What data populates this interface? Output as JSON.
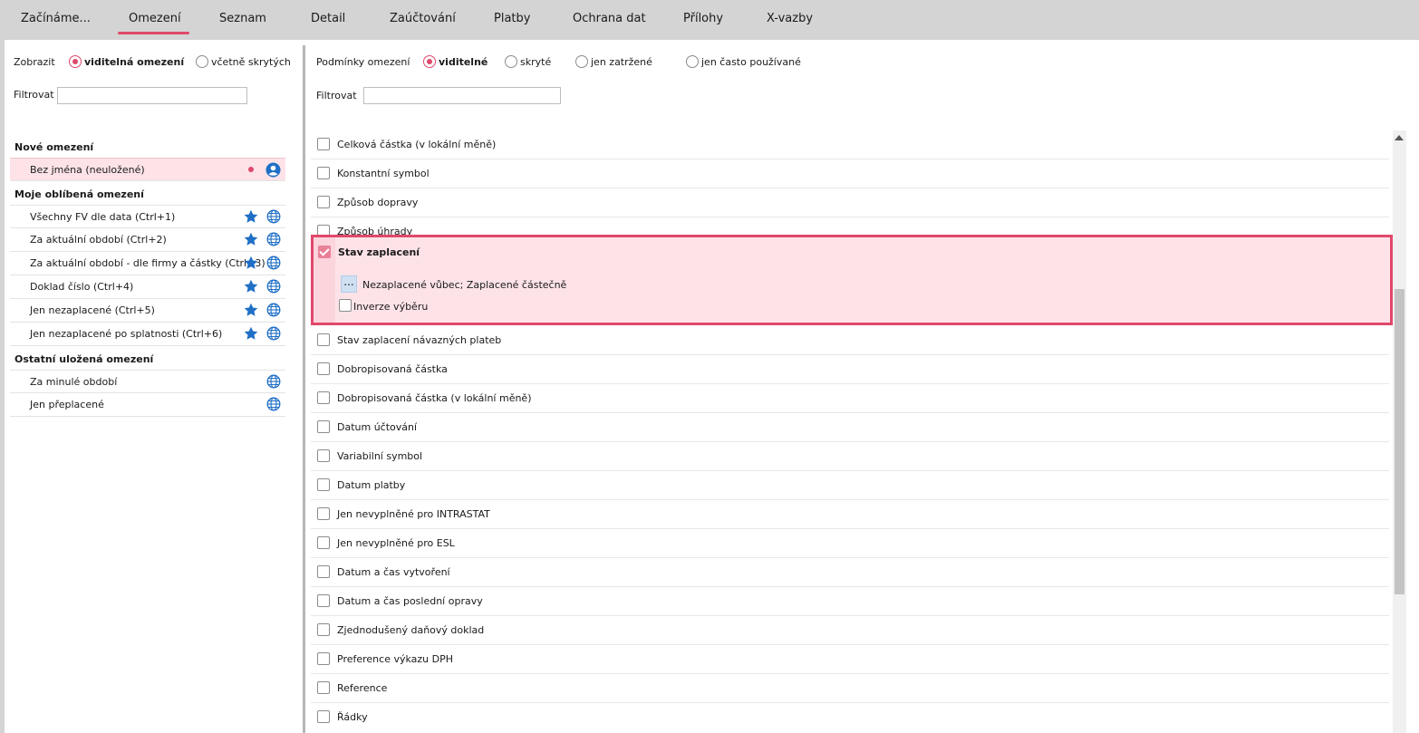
{
  "tabs": [
    {
      "label": "Začínáme...",
      "active": false
    },
    {
      "label": "Omezení",
      "active": true
    },
    {
      "label": "Seznam",
      "active": false
    },
    {
      "label": "Detail",
      "active": false
    },
    {
      "label": "Zaúčtování",
      "active": false
    },
    {
      "label": "Platby",
      "active": false
    },
    {
      "label": "Ochrana dat",
      "active": false
    },
    {
      "label": "Přílohy",
      "active": false
    },
    {
      "label": "X-vazby",
      "active": false
    }
  ],
  "left": {
    "show_label": "Zobrazit",
    "show_opt_visible": "viditelná omezení",
    "show_opt_hidden": "včetně skrytých",
    "filter_label": "Filtrovat",
    "filter_value": "",
    "sections": {
      "new": "Nové omezení",
      "favorites": "Moje oblíbená omezení",
      "other": "Ostatní uložená omezení"
    },
    "new_item": "Bez jména (neuložené)",
    "favorites": [
      "Všechny FV dle data (Ctrl+1)",
      "Za aktuální období (Ctrl+2)",
      "Za aktuální období - dle firmy a částky (Ctrl+3)",
      "Doklad číslo (Ctrl+4)",
      "Jen nezaplacené (Ctrl+5)",
      "Jen nezaplacené po splatnosti (Ctrl+6)"
    ],
    "others": [
      "Za minulé období",
      "Jen přeplacené"
    ]
  },
  "right": {
    "cond_label": "Podmínky omezení",
    "opt_visible": "viditelné",
    "opt_hidden": "skryté",
    "opt_checked": "jen zatržené",
    "opt_frequent": "jen často používané",
    "filter_label": "Filtrovat",
    "filter_value": "",
    "rows_top": [
      "Celková částka (v lokální měně)",
      "Konstantní symbol",
      "Způsob dopravy",
      "Způsob úhrady"
    ],
    "selected": {
      "title": "Stav zaplacení",
      "dots": "...",
      "value": "Nezaplacené vůbec; Zaplacené částečně",
      "inverse": "Inverze výběru"
    },
    "rows_bottom": [
      "Stav zaplacení návazných plateb",
      "Dobropisovaná částka",
      "Dobropisovaná částka (v lokální měně)",
      "Datum účtování",
      "Variabilní symbol",
      "Datum platby",
      "Jen nevyplněné pro INTRASTAT",
      "Jen nevyplněné pro ESL",
      "Datum a čas vytvoření",
      "Datum a čas poslední opravy",
      "Zjednodušený daňový doklad",
      "Preference výkazu DPH",
      "Reference",
      "Řádky"
    ]
  },
  "colors": {
    "accent": "#e0486b",
    "icon_blue": "#1f6fc6",
    "selected_bg": "#fde3e8"
  }
}
